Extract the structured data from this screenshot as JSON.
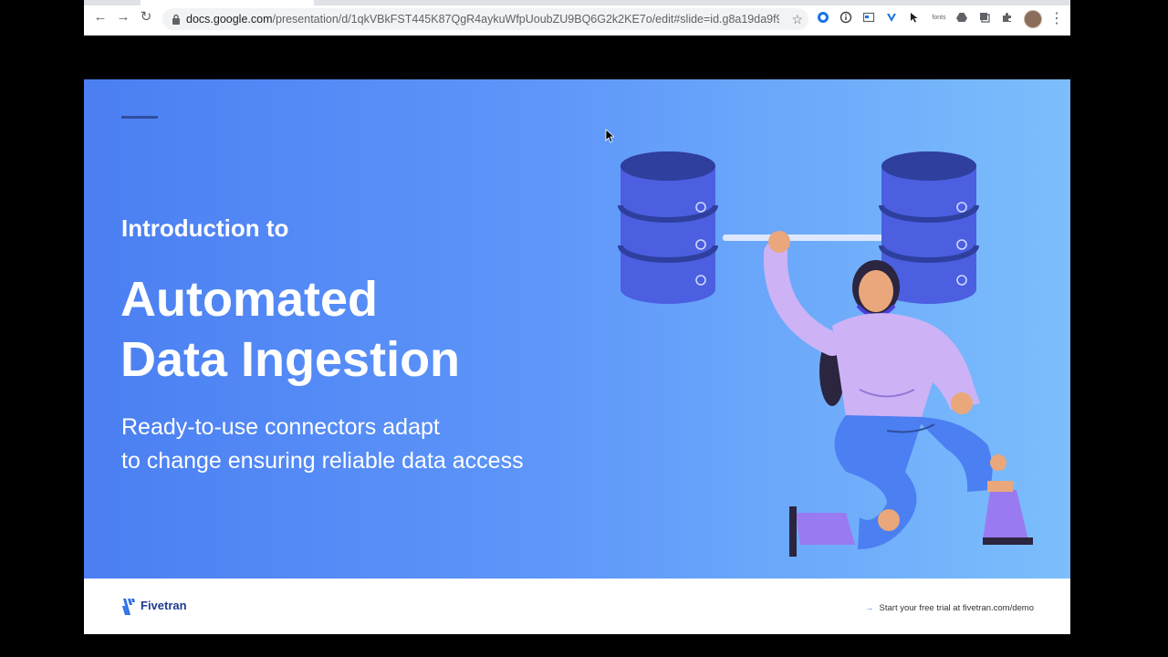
{
  "browser": {
    "back_icon": "←",
    "forward_icon": "→",
    "reload_icon": "↻",
    "url_host": "docs.google.com",
    "url_path": "/presentation/d/1qkVBkFST445K87QgR4aykuWfpUoubZU9BQ6G2k2KE7o/edit#slide=id.g8a19da9f9f_0_...",
    "extension_icons": [
      "circle-ext-icon",
      "info-ext-icon",
      "window-ext-icon",
      "v-ext-icon",
      "cursor-ext-icon",
      "fonts-ext-icon",
      "drive-ext-icon",
      "copy-ext-icon",
      "puzzle-ext-icon"
    ],
    "fonts_label": "fonts"
  },
  "slide": {
    "kicker": "Introduction to",
    "title_line1": "Automated",
    "title_line2": "Data Ingestion",
    "subtitle_line1": "Ready-to-use connectors adapt",
    "subtitle_line2": "to change ensuring reliable data access",
    "gradient_start": "#4b7ff2",
    "gradient_end": "#7cbefc"
  },
  "footer": {
    "brand": "Fivetran",
    "cta": "Start your free trial at fivetran.com/demo",
    "cta_arrow": "→"
  }
}
